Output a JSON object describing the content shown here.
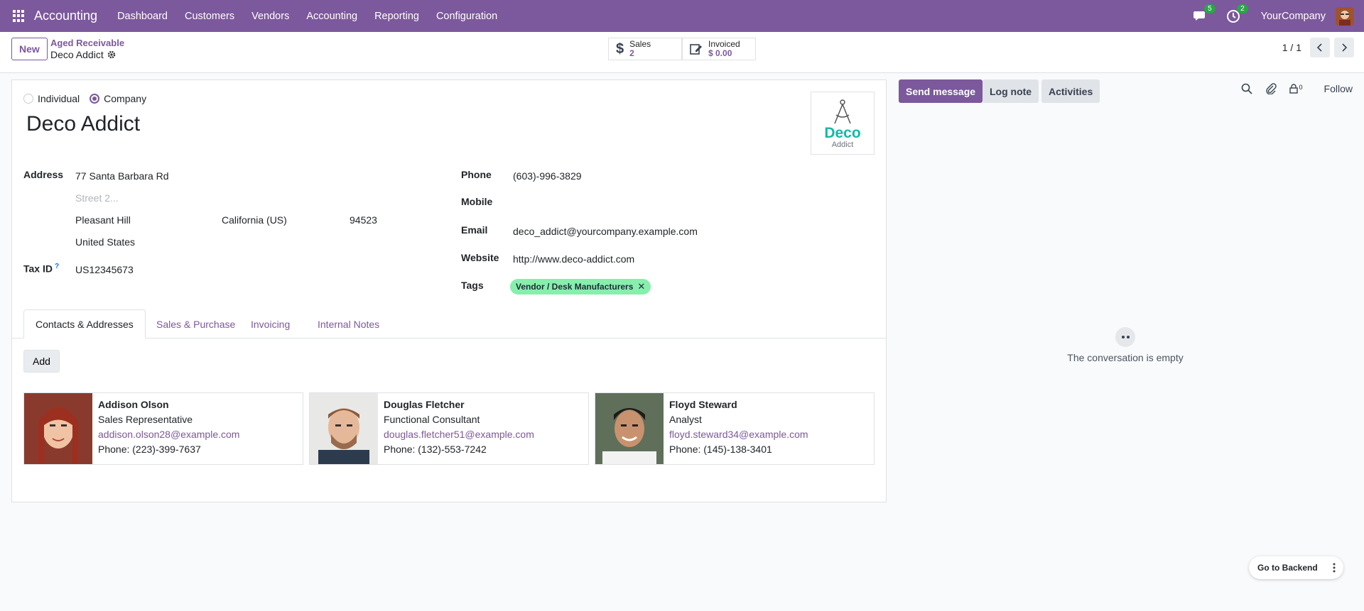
{
  "topbar": {
    "app_name": "Accounting",
    "menu": [
      "Dashboard",
      "Customers",
      "Vendors",
      "Accounting",
      "Reporting",
      "Configuration"
    ],
    "messages_badge": "5",
    "activities_badge": "2",
    "company": "YourCompany"
  },
  "control": {
    "new_label": "New",
    "breadcrumb_parent": "Aged Receivable",
    "breadcrumb_current": "Deco Addict",
    "stat_sales_label": "Sales",
    "stat_sales_value": "2",
    "stat_invoiced_label": "Invoiced",
    "stat_invoiced_value": "$ 0.00",
    "pager": "1 / 1"
  },
  "form": {
    "radio_individual": "Individual",
    "radio_company": "Company",
    "name": "Deco Addict",
    "logo_main": "Deco",
    "logo_sub": "Addict",
    "address_label": "Address",
    "street": "77 Santa Barbara Rd",
    "street2_placeholder": "Street 2...",
    "city": "Pleasant Hill",
    "state": "California (US)",
    "zip": "94523",
    "country": "United States",
    "taxid_label": "Tax ID",
    "taxid_help": "?",
    "taxid": "US12345673",
    "phone_label": "Phone",
    "phone": "(603)-996-3829",
    "mobile_label": "Mobile",
    "email_label": "Email",
    "email": "deco_addict@yourcompany.example.com",
    "website_label": "Website",
    "website": "http://www.deco-addict.com",
    "tags_label": "Tags",
    "tag": "Vendor / Desk Manufacturers"
  },
  "tabs": [
    "Contacts & Addresses",
    "Sales & Purchase",
    "Invoicing",
    "Internal Notes"
  ],
  "add_label": "Add",
  "contacts": [
    {
      "name": "Addison Olson",
      "title": "Sales Representative",
      "email": "addison.olson28@example.com",
      "phone": "Phone: (223)-399-7637"
    },
    {
      "name": "Douglas Fletcher",
      "title": "Functional Consultant",
      "email": "douglas.fletcher51@example.com",
      "phone": "Phone: (132)-553-7242"
    },
    {
      "name": "Floyd Steward",
      "title": "Analyst",
      "email": "floyd.steward34@example.com",
      "phone": "Phone: (145)-138-3401"
    }
  ],
  "chatter": {
    "send_message": "Send message",
    "log_note": "Log note",
    "activities": "Activities",
    "followers_count": "0",
    "follow": "Follow",
    "empty_text": "The conversation is empty"
  },
  "backend_label": "Go to Backend",
  "colors": {
    "brand": "#7c589c",
    "tag": "#86efac",
    "logo": "#14b8a6"
  }
}
